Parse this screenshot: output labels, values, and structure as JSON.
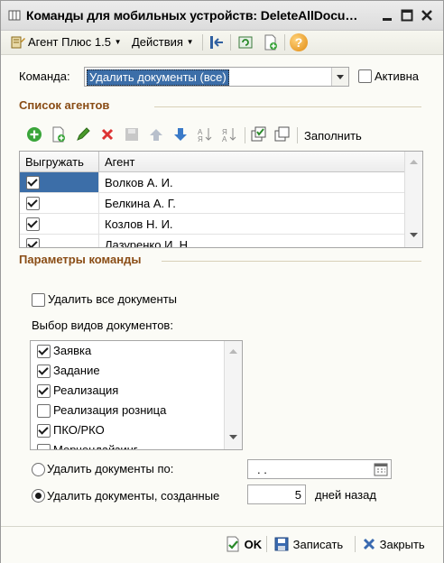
{
  "window": {
    "title": "Команды для мобильных устройств: DeleteAllDocu…",
    "controls": [
      "minimize",
      "maximize",
      "close"
    ]
  },
  "toolbar": {
    "agent_menu": "Агент Плюс 1.5",
    "actions_menu": "Действия",
    "help_icon": "?"
  },
  "form": {
    "command_label": "Команда:",
    "command_value": "Удалить документы (все)",
    "active_label": "Активна",
    "active_checked": false
  },
  "agents": {
    "section_title": "Список агентов",
    "fill_button": "Заполнить",
    "columns": [
      "Выгружать",
      "Агент"
    ],
    "rows": [
      {
        "export": true,
        "agent": "Волков А. И."
      },
      {
        "export": true,
        "agent": "Белкина А. Г."
      },
      {
        "export": true,
        "agent": "Козлов Н. И."
      },
      {
        "export": true,
        "agent": "Лазуренко И. Н."
      }
    ]
  },
  "params": {
    "section_title": "Параметры команды",
    "delete_all_label": "Удалить все документы",
    "delete_all_checked": false,
    "doc_types_label": "Выбор видов документов:",
    "doc_types": [
      {
        "label": "Заявка",
        "checked": true
      },
      {
        "label": "Задание",
        "checked": true
      },
      {
        "label": "Реализация",
        "checked": true
      },
      {
        "label": "Реализация розница",
        "checked": false
      },
      {
        "label": "ПКО/РКО",
        "checked": true
      },
      {
        "label": "Мерчендайзинг",
        "checked": false
      }
    ],
    "delete_by_label": "Удалить документы по:",
    "delete_by_date": ". .",
    "delete_created_label": "Удалить документы, созданные",
    "days_value": "5",
    "days_suffix": "дней назад",
    "selected_option": "delete_created"
  },
  "footer": {
    "ok": "OK",
    "save": "Записать",
    "close": "Закрыть"
  },
  "colors": {
    "section_title": "#8a4d16",
    "selection": "#3c6ea8",
    "background": "#fbfbf6"
  }
}
